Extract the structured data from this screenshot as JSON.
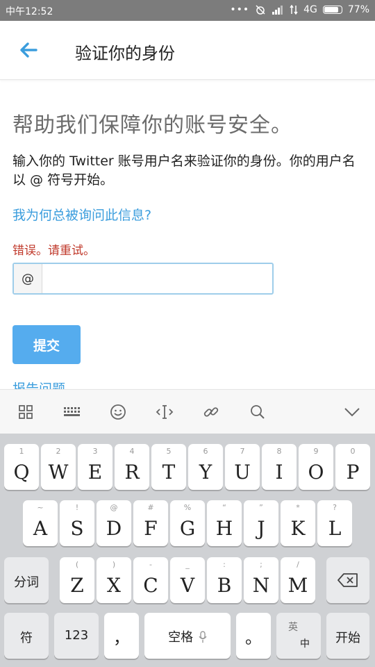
{
  "status_bar": {
    "time": "中午12:52",
    "network": "4G",
    "battery": "77%"
  },
  "header": {
    "title": "验证你的身份",
    "back_icon": "arrow-left-icon"
  },
  "main": {
    "headline": "帮助我们保障你的账号安全。",
    "description": "输入你的 Twitter 账号用户名来验证你的身份。你的用户名以 @ 符号开始。",
    "help_link": "我为何总被询问此信息?",
    "error": "错误。请重试。",
    "username_prefix": "@",
    "username_value": "",
    "submit_label": "提交",
    "report_link": "报告问题"
  },
  "keyboard_toolbar": {
    "icons": [
      "grid-icon",
      "keyboard-icon",
      "emoji-icon",
      "cursor-icon",
      "link-icon",
      "search-icon",
      "chevron-down-icon"
    ]
  },
  "keyboard": {
    "row1": [
      {
        "key": "Q",
        "sub": "1"
      },
      {
        "key": "W",
        "sub": "2"
      },
      {
        "key": "E",
        "sub": "3"
      },
      {
        "key": "R",
        "sub": "4"
      },
      {
        "key": "T",
        "sub": "5"
      },
      {
        "key": "Y",
        "sub": "6"
      },
      {
        "key": "U",
        "sub": "7"
      },
      {
        "key": "I",
        "sub": "8"
      },
      {
        "key": "O",
        "sub": "9"
      },
      {
        "key": "P",
        "sub": "0"
      }
    ],
    "row2": [
      {
        "key": "A",
        "sub": "~"
      },
      {
        "key": "S",
        "sub": "!"
      },
      {
        "key": "D",
        "sub": "@"
      },
      {
        "key": "F",
        "sub": "#"
      },
      {
        "key": "G",
        "sub": "%"
      },
      {
        "key": "H",
        "sub": "“"
      },
      {
        "key": "J",
        "sub": "”"
      },
      {
        "key": "K",
        "sub": "*"
      },
      {
        "key": "L",
        "sub": "?"
      }
    ],
    "row3": [
      {
        "key": "Z",
        "sub": "("
      },
      {
        "key": "X",
        "sub": ")"
      },
      {
        "key": "C",
        "sub": "-"
      },
      {
        "key": "V",
        "sub": "_"
      },
      {
        "key": "B",
        "sub": ":"
      },
      {
        "key": "N",
        "sub": ";"
      },
      {
        "key": "M",
        "sub": "/"
      }
    ],
    "fenci": "分词",
    "delete_icon": "backspace-icon",
    "symbol": "符",
    "num": "123",
    "comma": "，",
    "space": "空格",
    "period": "。",
    "lang_top": "英",
    "lang_bottom": "中",
    "enter": "开始"
  }
}
